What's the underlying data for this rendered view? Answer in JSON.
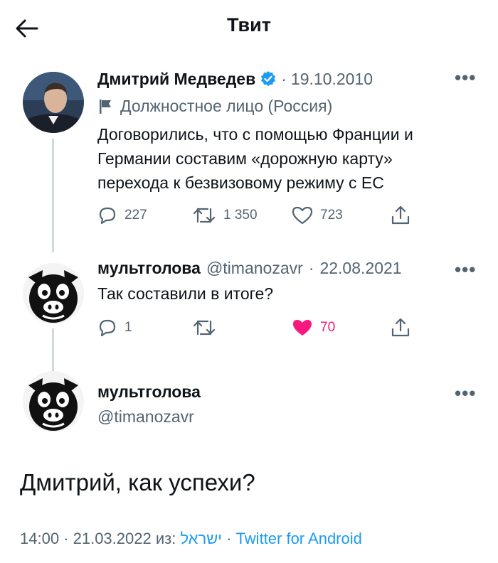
{
  "header": {
    "title": "Твит"
  },
  "tweet1": {
    "author_name": "Дмитрий Медведев",
    "separator": "·",
    "date": "19.10.2010",
    "label": "Должностное лицо (Россия)",
    "text_line1": "Договорились, что с помощью Франции и",
    "text_line2": "Германии составим «дорожную карту»",
    "text_line3": "перехода к безвизовому режиму с ЕС",
    "replies": "227",
    "retweets": "1 350",
    "likes": "723"
  },
  "tweet2": {
    "author_name": "мультголова",
    "handle": "@timanozavr",
    "separator": "·",
    "date": "22.08.2021",
    "text": "Так составили в итоге?",
    "replies": "1",
    "likes": "70"
  },
  "tweet3": {
    "author_name": "мультголова",
    "handle": "@timanozavr",
    "text": "Дмитрий, как успехи?",
    "footer_time": "14:00 · 21.03.2022 из: ",
    "footer_location": "ישראל",
    "footer_sep": " · ",
    "footer_client": "Twitter for Android"
  },
  "colors": {
    "verified": "#1d9bf0",
    "like_active": "#f91880",
    "muted": "#536471",
    "thread_line": "#cfd9de"
  },
  "icons": {
    "back": "arrow-left-icon",
    "verified": "verified-badge-icon",
    "label": "flag-icon",
    "reply": "reply-icon",
    "retweet": "retweet-icon",
    "like": "heart-icon",
    "share": "share-icon",
    "more": "more-dots-icon"
  }
}
